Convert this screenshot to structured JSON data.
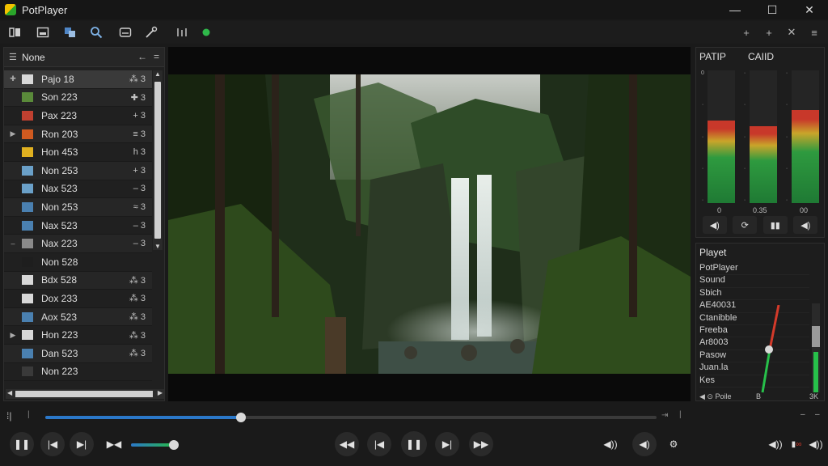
{
  "window": {
    "title": "PotPlayer",
    "minimize_icon": "minimize-icon",
    "maximize_icon": "maximize-icon",
    "close_icon": "close-icon"
  },
  "toolbar": {
    "icons": [
      "playlist-icon",
      "info-panel-icon",
      "capture-icon",
      "search-icon",
      "subtitle-icon",
      "tools-icon",
      "equalizer-icon",
      "status-dot-icon"
    ],
    "right_icons": [
      "pin-icon",
      "add-icon",
      "close-panel-icon",
      "menu-icon"
    ]
  },
  "playlist": {
    "title": "None",
    "items": [
      {
        "name": "Pajo 18",
        "meta": "⁂ 3",
        "thumb_color": "#d8d8d8",
        "arrow": "✚"
      },
      {
        "name": "Son 223",
        "meta": "✚ 3",
        "thumb_color": "#5a8a3a",
        "arrow": ""
      },
      {
        "name": "Pax 223",
        "meta": "+ 3",
        "thumb_color": "#c04030",
        "arrow": ""
      },
      {
        "name": "Ron 203",
        "meta": "≡ 3",
        "thumb_color": "#d05a20",
        "arrow": "▶"
      },
      {
        "name": "Hon 453",
        "meta": "h 3",
        "thumb_color": "#e0b020",
        "arrow": ""
      },
      {
        "name": "Non 253",
        "meta": "+ 3",
        "thumb_color": "#6aa0c8",
        "arrow": ""
      },
      {
        "name": "Nax 523",
        "meta": "– 3",
        "thumb_color": "#6aa0c8",
        "arrow": ""
      },
      {
        "name": "Non 253",
        "meta": "≈ 3",
        "thumb_color": "#4a80b0",
        "arrow": ""
      },
      {
        "name": "Nax 523",
        "meta": "– 3",
        "thumb_color": "#4a80b0",
        "arrow": ""
      },
      {
        "name": "Nax 223",
        "meta": "– 3",
        "thumb_color": "#8a8a8a",
        "arrow": "–"
      },
      {
        "name": "Non 528",
        "meta": "",
        "thumb_color": "#1e1e1e",
        "arrow": ""
      },
      {
        "name": "Bdx 528",
        "meta": "⁂ 3",
        "thumb_color": "#d8d8d8",
        "arrow": ""
      },
      {
        "name": "Dox 233",
        "meta": "⁂ 3",
        "thumb_color": "#d8d8d8",
        "arrow": ""
      },
      {
        "name": "Aox 523",
        "meta": "⁂ 3",
        "thumb_color": "#4a80b0",
        "arrow": ""
      },
      {
        "name": "Hon 223",
        "meta": "⁂ 3",
        "thumb_color": "#d8d8d8",
        "arrow": "▶"
      },
      {
        "name": "Dan 523",
        "meta": "⁂ 3",
        "thumb_color": "#4a80b0",
        "arrow": ""
      },
      {
        "name": "Non 223",
        "meta": "",
        "thumb_color": "#3a3a3a",
        "arrow": ""
      }
    ]
  },
  "equalizer": {
    "tab_left": "PATIP",
    "tab_right": "CAIID",
    "scale_top": "0",
    "label_left": "0",
    "label_mid": "0.35",
    "label_right": "00",
    "bars": [
      0.62,
      0.58,
      0.7
    ],
    "controls": [
      "speaker-icon",
      "refresh-icon",
      "bars-icon",
      "volume-icon"
    ]
  },
  "properties": {
    "title": "Playet",
    "items": [
      "PotPlayer",
      "Sound",
      "Sbich",
      "AE40031",
      "Ctanibble",
      "Freeba",
      "Ar8003",
      "Pasow",
      "Juan.la",
      "Kes"
    ],
    "footer_left": "◀ ⊙ Poile",
    "footer_mid": "B",
    "footer_right": "3K"
  },
  "playback": {
    "seek_progress": 0.32,
    "volume_level": 0.95,
    "left_buttons": [
      "pause-icon",
      "skip-back-icon",
      "skip-forward-icon",
      "frame-step-icon"
    ],
    "center_buttons": [
      "rewind-icon",
      "previous-icon",
      "pause-icon",
      "next-icon",
      "fast-forward-icon"
    ],
    "right_buttons": [
      "mute-icon",
      "audio-track-icon",
      "settings-icon"
    ]
  }
}
